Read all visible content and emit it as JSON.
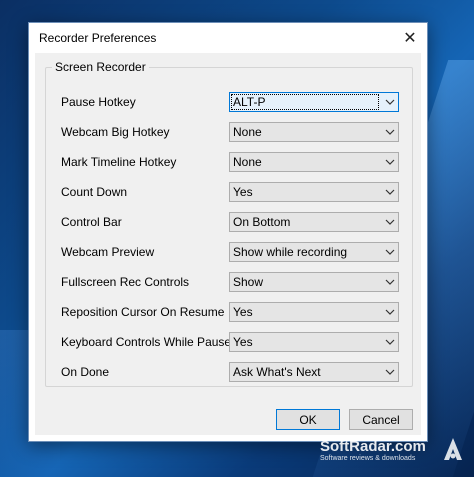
{
  "window": {
    "title": "Recorder Preferences",
    "close_glyph": "✕"
  },
  "group": {
    "legend": "Screen Recorder"
  },
  "settings": [
    {
      "label": "Pause Hotkey",
      "value": "ALT-P"
    },
    {
      "label": "Webcam Big Hotkey",
      "value": "None"
    },
    {
      "label": "Mark Timeline Hotkey",
      "value": "None"
    },
    {
      "label": "Count Down",
      "value": "Yes"
    },
    {
      "label": "Control Bar",
      "value": "On Bottom"
    },
    {
      "label": "Webcam Preview",
      "value": "Show while recording"
    },
    {
      "label": "Fullscreen Rec Controls",
      "value": "Show"
    },
    {
      "label": "Reposition Cursor On Resume",
      "value": "Yes"
    },
    {
      "label": "Keyboard Controls While Paused",
      "value": "Yes"
    },
    {
      "label": "On Done",
      "value": "Ask What's Next"
    }
  ],
  "buttons": {
    "ok": "OK",
    "cancel": "Cancel"
  },
  "watermark": {
    "name": "SoftRadar.com",
    "tagline": "Software reviews & downloads"
  },
  "colors": {
    "accent": "#0078d7",
    "desktop": "#0d4a8c"
  },
  "icons": {
    "close": "close-icon",
    "dropdown": "chevron-down-icon"
  }
}
